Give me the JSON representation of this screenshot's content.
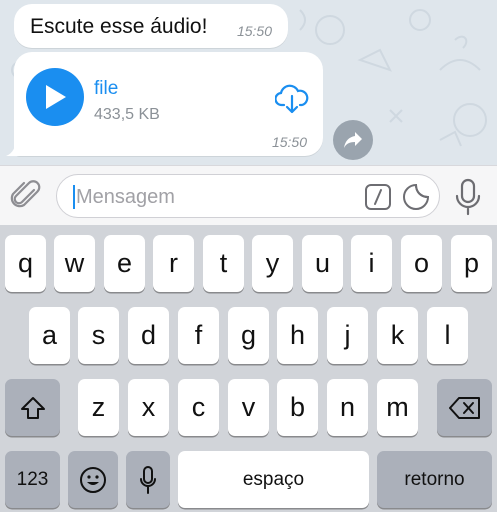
{
  "chat": {
    "text_message": {
      "text": "Escute esse áudio!",
      "time": "15:50"
    },
    "file_message": {
      "file_name": "file",
      "file_size": "433,5 KB",
      "time": "15:50"
    }
  },
  "input_bar": {
    "placeholder": "Mensagem",
    "icons": [
      "paperclip-icon",
      "slash-command-icon",
      "sticker-icon",
      "microphone-icon"
    ]
  },
  "keyboard": {
    "row1": [
      "q",
      "w",
      "e",
      "r",
      "t",
      "y",
      "u",
      "i",
      "o",
      "p"
    ],
    "row2": [
      "a",
      "s",
      "d",
      "f",
      "g",
      "h",
      "j",
      "k",
      "l"
    ],
    "row3": [
      "z",
      "x",
      "c",
      "v",
      "b",
      "n",
      "m"
    ],
    "numbers_label": "123",
    "space_label": "espaço",
    "return_label": "retorno"
  },
  "colors": {
    "accent": "#1a8ef0",
    "chat_background": "#dfe6ec",
    "keyboard_background": "#d1d4d9"
  }
}
